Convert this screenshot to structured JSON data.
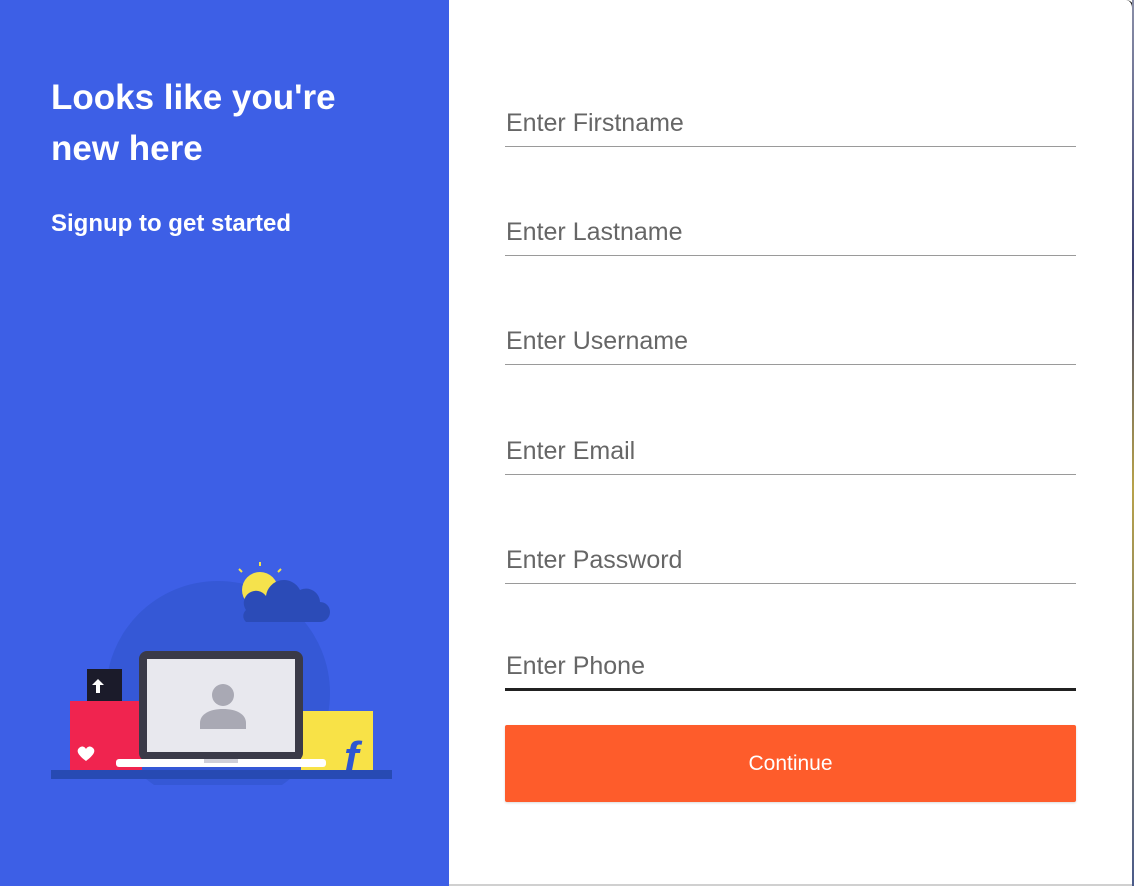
{
  "left_panel": {
    "headline": "Looks like you're new here",
    "subhead": "Signup to get started",
    "illustration": {
      "icons": [
        "sun-icon",
        "cloud-icon",
        "laptop-icon",
        "user-avatar-icon",
        "heart-icon",
        "upload-arrow-icon",
        "flipkart-f-icon"
      ],
      "background_color": "#3d5fe6"
    }
  },
  "form": {
    "fields": [
      {
        "placeholder": "Enter Firstname",
        "value": ""
      },
      {
        "placeholder": "Enter Lastname",
        "value": ""
      },
      {
        "placeholder": "Enter Username",
        "value": ""
      },
      {
        "placeholder": "Enter Email",
        "value": ""
      },
      {
        "placeholder": "Enter Password",
        "value": ""
      },
      {
        "placeholder": "Enter Phone",
        "value": ""
      }
    ],
    "continue_label": "Continue"
  },
  "colors": {
    "panel_blue": "#3d5fe6",
    "button_orange": "#fe5c2b",
    "text_white": "#ffffff"
  }
}
